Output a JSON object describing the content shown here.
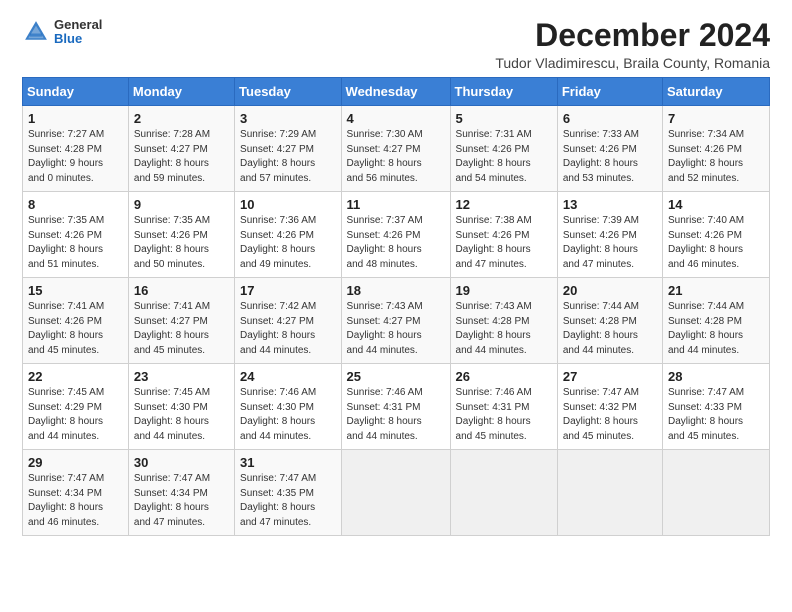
{
  "logo": {
    "general": "General",
    "blue": "Blue"
  },
  "title": "December 2024",
  "subtitle": "Tudor Vladimirescu, Braila County, Romania",
  "days_header": [
    "Sunday",
    "Monday",
    "Tuesday",
    "Wednesday",
    "Thursday",
    "Friday",
    "Saturday"
  ],
  "weeks": [
    [
      {
        "day": "1",
        "info": "Sunrise: 7:27 AM\nSunset: 4:28 PM\nDaylight: 9 hours\nand 0 minutes."
      },
      {
        "day": "2",
        "info": "Sunrise: 7:28 AM\nSunset: 4:27 PM\nDaylight: 8 hours\nand 59 minutes."
      },
      {
        "day": "3",
        "info": "Sunrise: 7:29 AM\nSunset: 4:27 PM\nDaylight: 8 hours\nand 57 minutes."
      },
      {
        "day": "4",
        "info": "Sunrise: 7:30 AM\nSunset: 4:27 PM\nDaylight: 8 hours\nand 56 minutes."
      },
      {
        "day": "5",
        "info": "Sunrise: 7:31 AM\nSunset: 4:26 PM\nDaylight: 8 hours\nand 54 minutes."
      },
      {
        "day": "6",
        "info": "Sunrise: 7:33 AM\nSunset: 4:26 PM\nDaylight: 8 hours\nand 53 minutes."
      },
      {
        "day": "7",
        "info": "Sunrise: 7:34 AM\nSunset: 4:26 PM\nDaylight: 8 hours\nand 52 minutes."
      }
    ],
    [
      {
        "day": "8",
        "info": "Sunrise: 7:35 AM\nSunset: 4:26 PM\nDaylight: 8 hours\nand 51 minutes."
      },
      {
        "day": "9",
        "info": "Sunrise: 7:35 AM\nSunset: 4:26 PM\nDaylight: 8 hours\nand 50 minutes."
      },
      {
        "day": "10",
        "info": "Sunrise: 7:36 AM\nSunset: 4:26 PM\nDaylight: 8 hours\nand 49 minutes."
      },
      {
        "day": "11",
        "info": "Sunrise: 7:37 AM\nSunset: 4:26 PM\nDaylight: 8 hours\nand 48 minutes."
      },
      {
        "day": "12",
        "info": "Sunrise: 7:38 AM\nSunset: 4:26 PM\nDaylight: 8 hours\nand 47 minutes."
      },
      {
        "day": "13",
        "info": "Sunrise: 7:39 AM\nSunset: 4:26 PM\nDaylight: 8 hours\nand 47 minutes."
      },
      {
        "day": "14",
        "info": "Sunrise: 7:40 AM\nSunset: 4:26 PM\nDaylight: 8 hours\nand 46 minutes."
      }
    ],
    [
      {
        "day": "15",
        "info": "Sunrise: 7:41 AM\nSunset: 4:26 PM\nDaylight: 8 hours\nand 45 minutes."
      },
      {
        "day": "16",
        "info": "Sunrise: 7:41 AM\nSunset: 4:27 PM\nDaylight: 8 hours\nand 45 minutes."
      },
      {
        "day": "17",
        "info": "Sunrise: 7:42 AM\nSunset: 4:27 PM\nDaylight: 8 hours\nand 44 minutes."
      },
      {
        "day": "18",
        "info": "Sunrise: 7:43 AM\nSunset: 4:27 PM\nDaylight: 8 hours\nand 44 minutes."
      },
      {
        "day": "19",
        "info": "Sunrise: 7:43 AM\nSunset: 4:28 PM\nDaylight: 8 hours\nand 44 minutes."
      },
      {
        "day": "20",
        "info": "Sunrise: 7:44 AM\nSunset: 4:28 PM\nDaylight: 8 hours\nand 44 minutes."
      },
      {
        "day": "21",
        "info": "Sunrise: 7:44 AM\nSunset: 4:28 PM\nDaylight: 8 hours\nand 44 minutes."
      }
    ],
    [
      {
        "day": "22",
        "info": "Sunrise: 7:45 AM\nSunset: 4:29 PM\nDaylight: 8 hours\nand 44 minutes."
      },
      {
        "day": "23",
        "info": "Sunrise: 7:45 AM\nSunset: 4:30 PM\nDaylight: 8 hours\nand 44 minutes."
      },
      {
        "day": "24",
        "info": "Sunrise: 7:46 AM\nSunset: 4:30 PM\nDaylight: 8 hours\nand 44 minutes."
      },
      {
        "day": "25",
        "info": "Sunrise: 7:46 AM\nSunset: 4:31 PM\nDaylight: 8 hours\nand 44 minutes."
      },
      {
        "day": "26",
        "info": "Sunrise: 7:46 AM\nSunset: 4:31 PM\nDaylight: 8 hours\nand 45 minutes."
      },
      {
        "day": "27",
        "info": "Sunrise: 7:47 AM\nSunset: 4:32 PM\nDaylight: 8 hours\nand 45 minutes."
      },
      {
        "day": "28",
        "info": "Sunrise: 7:47 AM\nSunset: 4:33 PM\nDaylight: 8 hours\nand 45 minutes."
      }
    ],
    [
      {
        "day": "29",
        "info": "Sunrise: 7:47 AM\nSunset: 4:34 PM\nDaylight: 8 hours\nand 46 minutes."
      },
      {
        "day": "30",
        "info": "Sunrise: 7:47 AM\nSunset: 4:34 PM\nDaylight: 8 hours\nand 47 minutes."
      },
      {
        "day": "31",
        "info": "Sunrise: 7:47 AM\nSunset: 4:35 PM\nDaylight: 8 hours\nand 47 minutes."
      },
      {
        "day": "",
        "info": ""
      },
      {
        "day": "",
        "info": ""
      },
      {
        "day": "",
        "info": ""
      },
      {
        "day": "",
        "info": ""
      }
    ]
  ]
}
